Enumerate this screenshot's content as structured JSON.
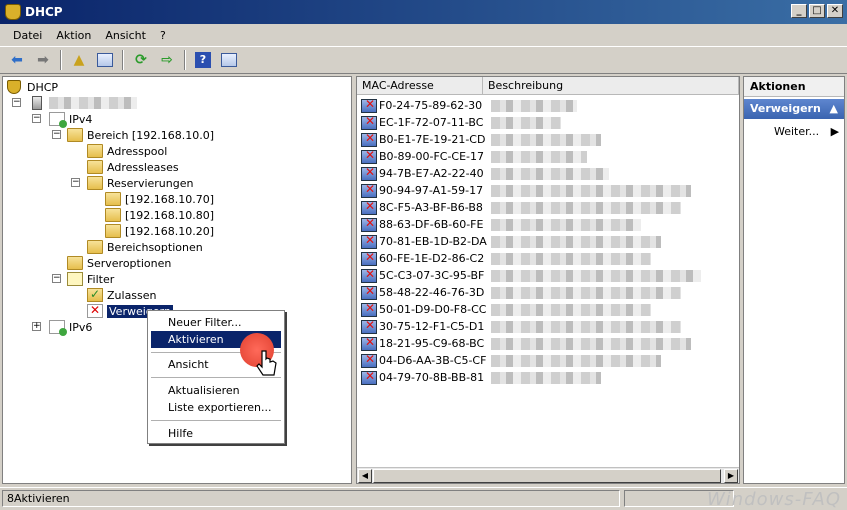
{
  "window": {
    "title": "DHCP"
  },
  "menubar": [
    "Datei",
    "Aktion",
    "Ansicht",
    "?"
  ],
  "tree": {
    "root": "DHCP",
    "ipv4": "IPv4",
    "bereich": "Bereich [192.168.10.0]",
    "adresspool": "Adresspool",
    "adressleases": "Adressleases",
    "reservierungen": "Reservierungen",
    "res1": "[192.168.10.70]",
    "res2": "[192.168.10.80]",
    "res3": "[192.168.10.20]",
    "bereichsoptionen": "Bereichsoptionen",
    "serveroptionen": "Serveroptionen",
    "filter": "Filter",
    "zulassen": "Zulassen",
    "verweigern": "Verweigern",
    "ipv6": "IPv6"
  },
  "context_menu": {
    "neuer_filter": "Neuer Filter...",
    "aktivieren": "Aktivieren",
    "ansicht": "Ansicht",
    "aktualisieren": "Aktualisieren",
    "liste_exportieren": "Liste exportieren...",
    "hilfe": "Hilfe"
  },
  "list": {
    "columns": [
      "MAC-Adresse",
      "Beschreibung"
    ],
    "rows": [
      "F0-24-75-89-62-30",
      "EC-1F-72-07-11-BC",
      "B0-E1-7E-19-21-CD",
      "B0-89-00-FC-CE-17",
      "94-7B-E7-A2-22-40",
      "90-94-97-A1-59-17",
      "8C-F5-A3-BF-B6-B8",
      "88-63-DF-6B-60-FE",
      "70-81-EB-1D-B2-DA",
      "60-FE-1E-D2-86-C2",
      "5C-C3-07-3C-95-BF",
      "58-48-22-46-76-3D",
      "50-01-D9-D0-F8-CC",
      "30-75-12-F1-C5-D1",
      "18-21-95-C9-68-BC",
      "04-D6-AA-3B-C5-CF",
      "04-79-70-8B-BB-81"
    ]
  },
  "actions": {
    "title": "Aktionen",
    "section": "Verweigern",
    "item": "Weiter..."
  },
  "status": {
    "text": "8Aktivieren",
    "watermark": "Windows-FAQ"
  },
  "icons": [
    "back-arrow-icon",
    "forward-arrow-icon",
    "up-folder-icon",
    "refresh-icon",
    "export-icon",
    "help-icon"
  ]
}
